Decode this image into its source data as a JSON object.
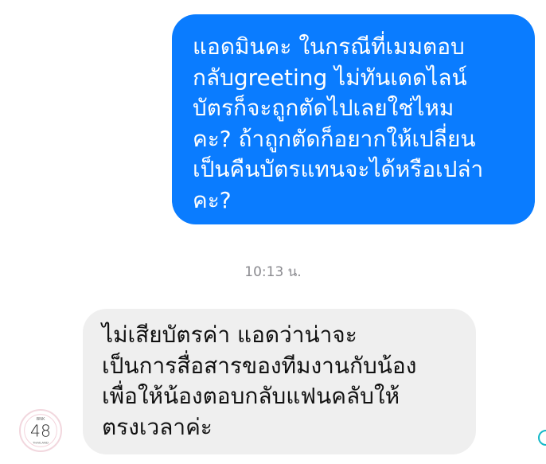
{
  "messages": {
    "outgoing_text": "แอดมินคะ ในกรณีที่เมมตอบ\nกลับgreeting ไม่ทันเดดไลน์\nบัตรก็จะถูกตัดไปเลยใช่ไหม\nคะ? ถ้าถูกตัดก็อยากให้เปลี่ยน\nเป็นคืนบัตรแทนจะได้หรือเปล่า\nคะ?",
    "timestamp": "10:13 น.",
    "incoming_text": "ไม่เสียบัตรค่า แอดว่าน่าจะ\nเป็นการสื่อสารของทีมงานกับน้อง\nเพื่อให้น้องตอบกลับแฟนคลับให้\nตรงเวลาค่ะ"
  },
  "avatar": {
    "logo_number": "48",
    "logo_top": "BNK",
    "logo_bottom": "THAILAND"
  },
  "colors": {
    "outgoing_bubble": "#0a7cff",
    "incoming_bubble": "#efefef",
    "timestamp": "#8a8a8f",
    "edge_icon": "#14b8c8"
  },
  "icons": {
    "avatar": "bnk48-logo-icon",
    "edge": "circle-icon"
  }
}
